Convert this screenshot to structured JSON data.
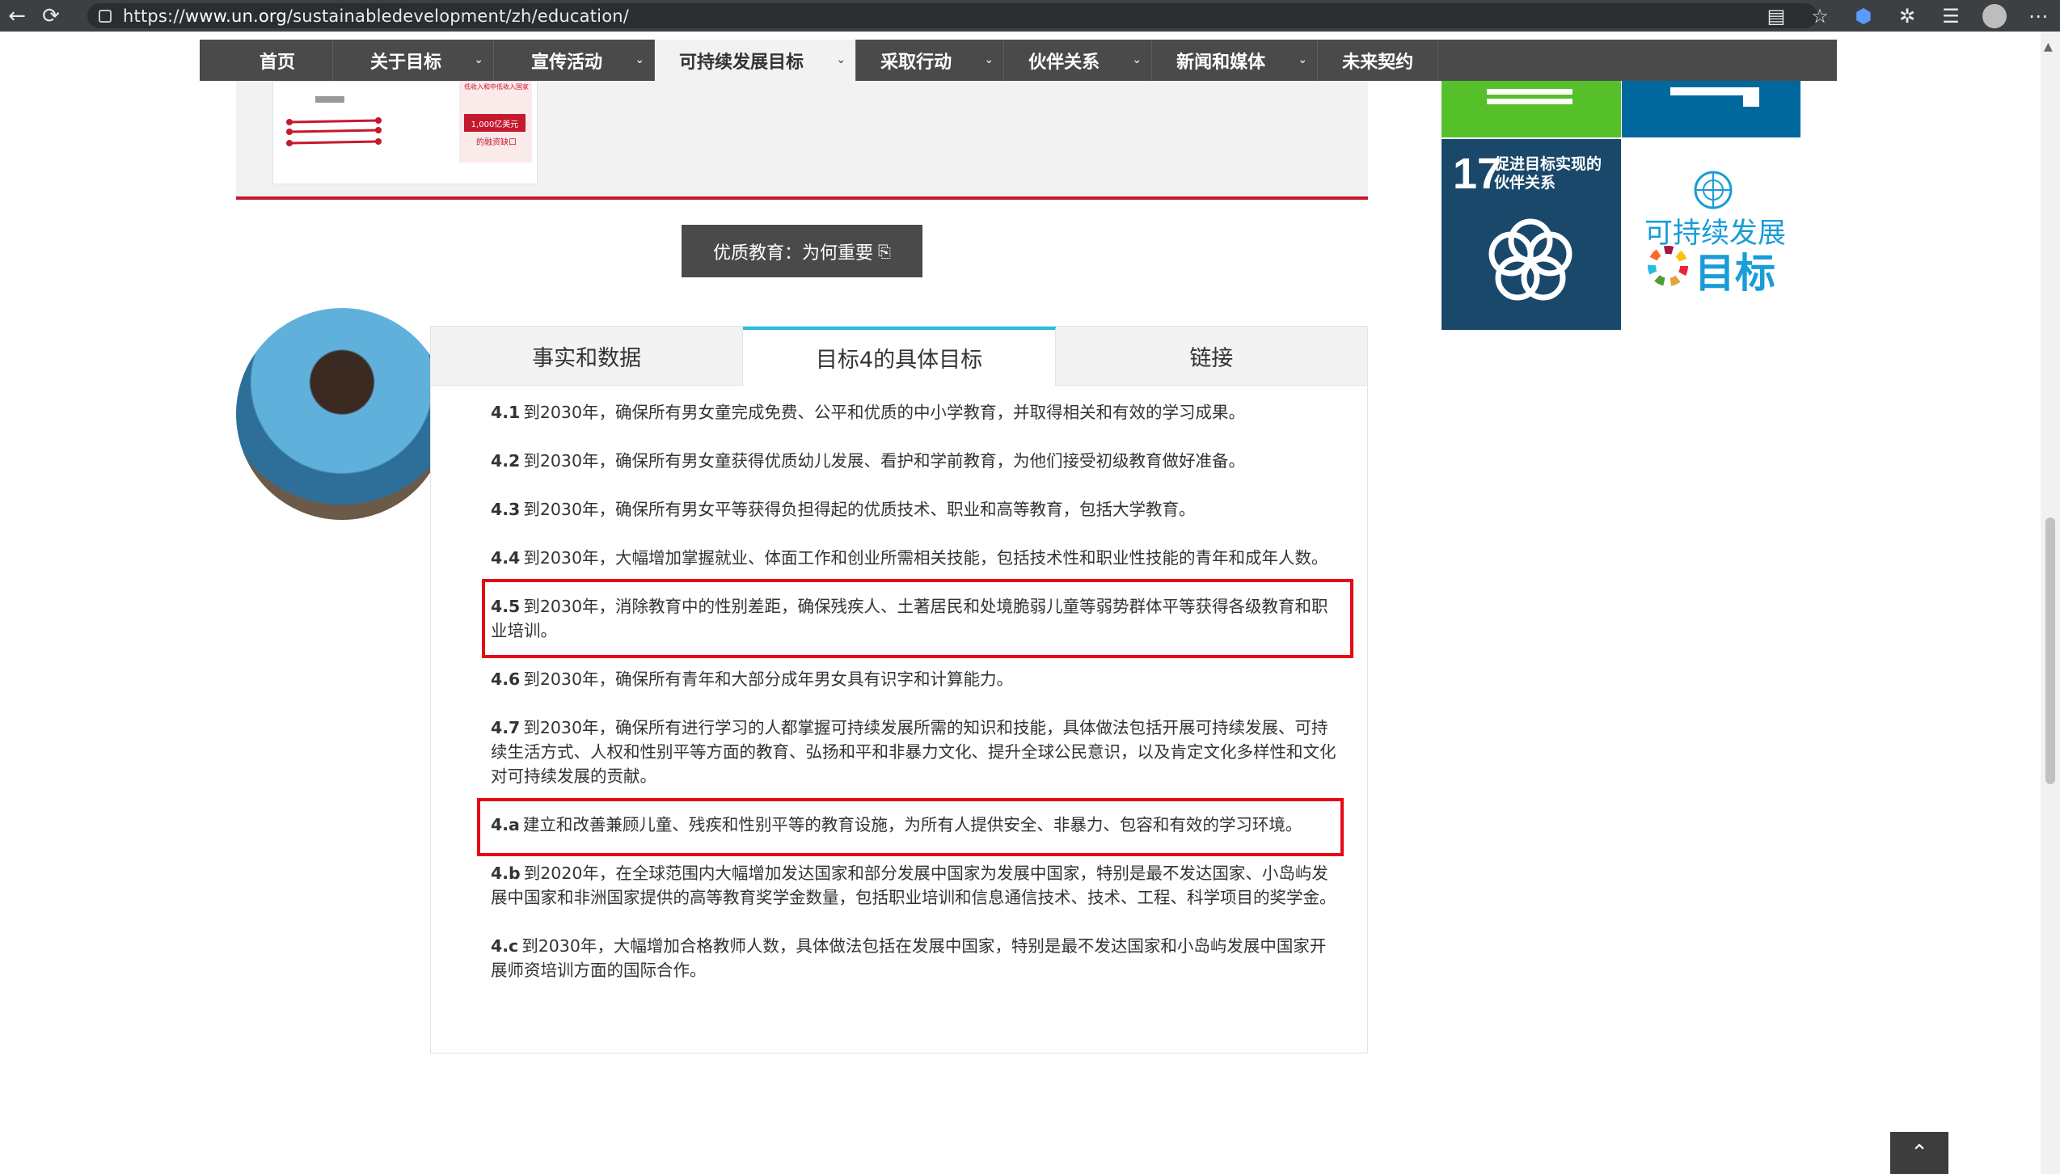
{
  "browser": {
    "url_prefix": "https://",
    "url_host": "www.un.org",
    "url_path": "/sustainabledevelopment/zh/education/"
  },
  "nav": {
    "items": [
      {
        "label": "首页",
        "has_menu": false
      },
      {
        "label": "关于目标",
        "has_menu": true
      },
      {
        "label": "宣传活动",
        "has_menu": true
      },
      {
        "label": "可持续发展目标",
        "has_menu": true,
        "active": true
      },
      {
        "label": "采取行动",
        "has_menu": true
      },
      {
        "label": "伙伴关系",
        "has_menu": true
      },
      {
        "label": "新闻和媒体",
        "has_menu": true
      },
      {
        "label": "未来契约",
        "has_menu": false
      }
    ]
  },
  "infographic": {
    "callout_top": "低收入和中低收入国家",
    "callout_value": "1,000亿美元",
    "callout_bottom": "的融资缺口"
  },
  "pdf_button": {
    "label": "优质教育：为何重要",
    "icon": "external-doc-icon"
  },
  "tabs": [
    {
      "label": "事实和数据"
    },
    {
      "label": "目标4的具体目标",
      "active": true
    },
    {
      "label": "链接"
    }
  ],
  "targets": [
    {
      "num": "4.1",
      "text": "到2030年，确保所有男女童完成免费、公平和优质的中小学教育，并取得相关和有效的学习成果。"
    },
    {
      "num": "4.2",
      "text": "到2030年，确保所有男女童获得优质幼儿发展、看护和学前教育，为他们接受初级教育做好准备。"
    },
    {
      "num": "4.3",
      "text": "到2030年，确保所有男女平等获得负担得起的优质技术、职业和高等教育，包括大学教育。"
    },
    {
      "num": "4.4",
      "text": "到2030年，大幅增加掌握就业、体面工作和创业所需相关技能，包括技术性和职业性技能的青年和成年人数。"
    },
    {
      "num": "4.5",
      "text": "到2030年，消除教育中的性别差距，确保残疾人、土著居民和处境脆弱儿童等弱势群体平等获得各级教育和职业培训。"
    },
    {
      "num": "4.6",
      "text": "到2030年，确保所有青年和大部分成年男女具有识字和计算能力。"
    },
    {
      "num": "4.7",
      "text": "到2030年，确保所有进行学习的人都掌握可持续发展所需的知识和技能，具体做法包括开展可持续发展、可持续生活方式、人权和性别平等方面的教育、弘扬和平和非暴力文化、提升全球公民意识，以及肯定文化多样性和文化对可持续发展的贡献。"
    },
    {
      "num": "4.a",
      "text": "建立和改善兼顾儿童、残疾和性别平等的教育设施，为所有人提供安全、非暴力、包容和有效的学习环境。"
    },
    {
      "num": "4.b",
      "text": "到2020年，在全球范围内大幅增加发达国家和部分发展中国家为发展中国家，特别是最不发达国家、小岛屿发展中国家和非洲国家提供的高等教育奖学金数量，包括职业培训和信息通信技术、技术、工程、科学项目的奖学金。"
    },
    {
      "num": "4.c",
      "text": "到2030年，大幅增加合格教师人数，具体做法包括在发展中国家，特别是最不发达国家和小岛屿发展中国家开展师资培训方面的国际合作。"
    }
  ],
  "sidebar": {
    "goal17_number": "17",
    "goal17_title_line1": "促进目标实现的",
    "goal17_title_line2": "伙伴关系",
    "sdg_logo_line1": "可持续发展",
    "sdg_logo_line2": "目标"
  },
  "colors": {
    "nav_bg": "#4a4a4a",
    "highlight_red": "#e50914",
    "tab_accent": "#26bde2",
    "goal17": "#19486a",
    "goal15": "#56c02b",
    "goal6": "#00689d"
  }
}
